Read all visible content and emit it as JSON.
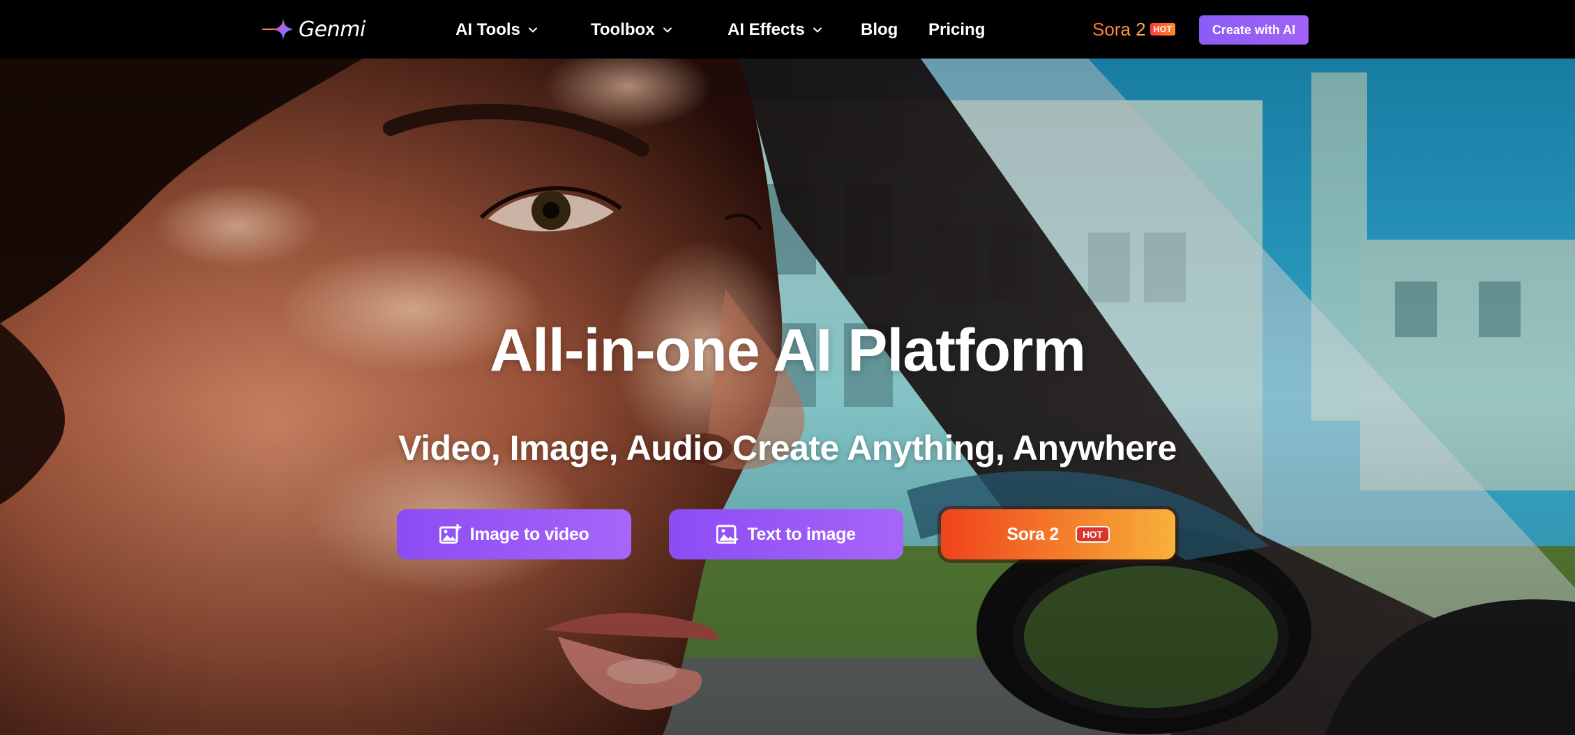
{
  "nav": {
    "logo_text": "Genmi",
    "items": [
      {
        "label": "AI Tools",
        "has_dropdown": true
      },
      {
        "label": "Toolbox",
        "has_dropdown": true
      },
      {
        "label": "AI Effects",
        "has_dropdown": true
      },
      {
        "label": "Blog",
        "has_dropdown": false
      },
      {
        "label": "Pricing",
        "has_dropdown": false
      }
    ],
    "sora_label": "Sora 2",
    "sora_badge": "HOT",
    "create_button": "Create with AI"
  },
  "hero": {
    "title": "All-in-one AI Platform",
    "subtitle": "Video, Image, Audio Create Anything, Anywhere",
    "buttons": [
      {
        "label": "Image to video",
        "icon": "image-video-icon"
      },
      {
        "label": "Text to image",
        "icon": "image-icon"
      },
      {
        "label": "Sora 2",
        "badge": "HOT"
      }
    ]
  },
  "colors": {
    "brand_purple": "#8b5cf6",
    "sora_orange": "#f0441c",
    "sora_yellow": "#f8b13a",
    "hot_red": "#d9352c"
  }
}
